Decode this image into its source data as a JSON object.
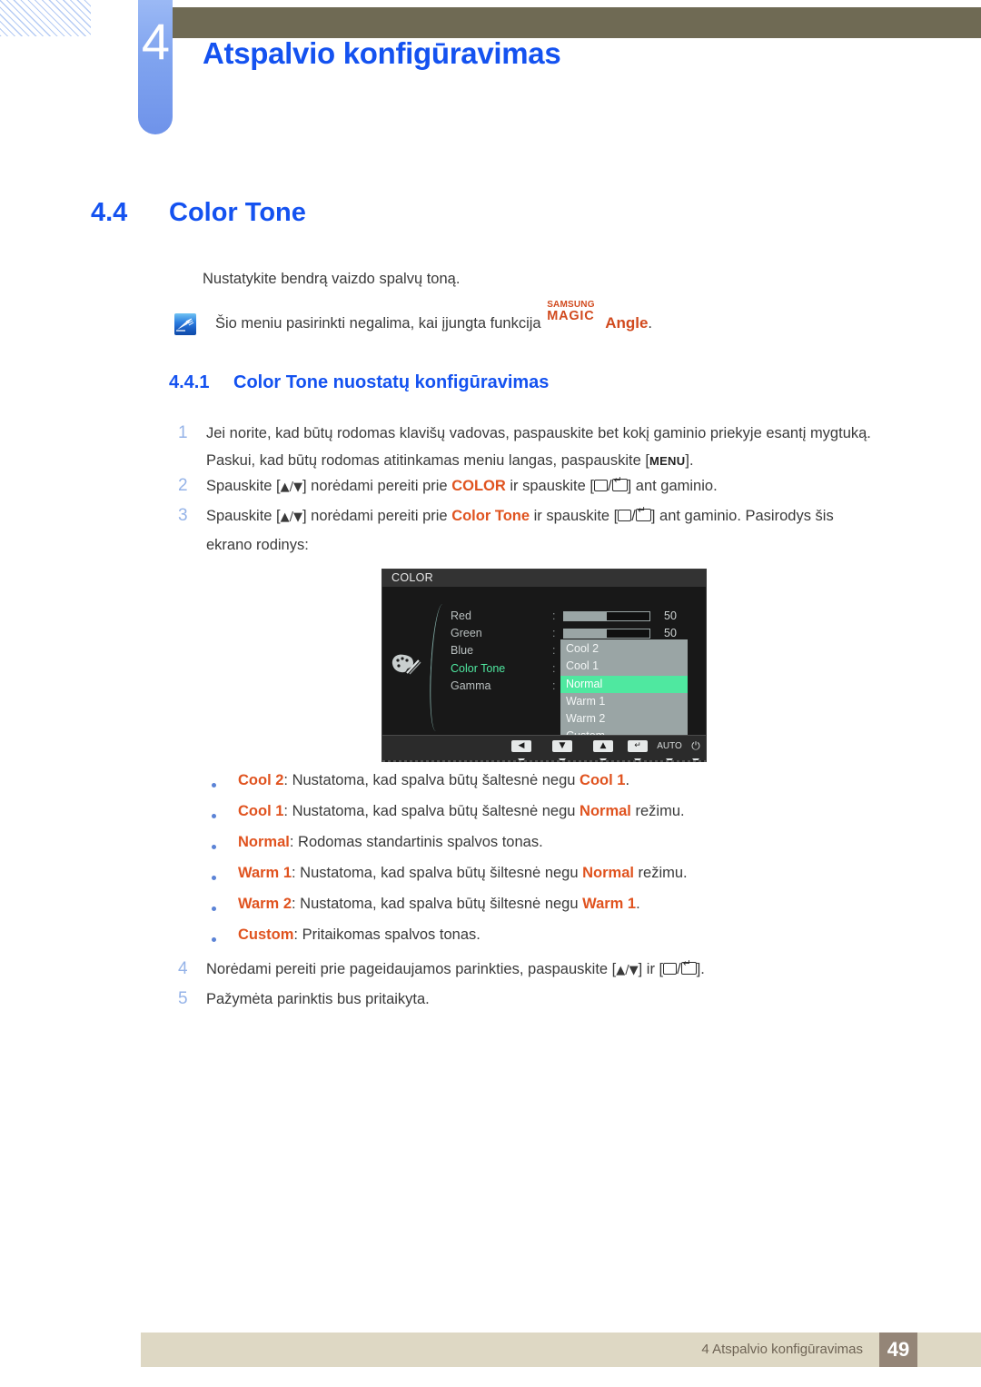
{
  "header": {
    "chapter_number": "4",
    "chapter_title": "Atspalvio konfigūravimas"
  },
  "section": {
    "number": "4.4",
    "title": "Color Tone"
  },
  "intro": "Nustatykite bendrą vaizdo spalvų toną.",
  "note": {
    "icon": "note-pen-icon",
    "text_before": "Šio meniu pasirinkti negalima, kai įjungta funkcija ",
    "logo_samsung": "SAMSUNG",
    "logo_magic": "MAGIC",
    "logo_angle": "Angle",
    "text_after": "."
  },
  "subsection": {
    "number": "4.4.1",
    "title": "Color Tone nuostatų konfigūravimas"
  },
  "steps": [
    {
      "num": "1",
      "line1_a": "Jei norite, kad būtų rodomas klavišų vadovas, paspauskite bet kokį gaminio priekyje esantį mygtuką.",
      "line2_a": "Paskui, kad būtų rodomas atitinkamas meniu langas, paspauskite [",
      "line2_key": "MENU",
      "line2_b": "]."
    },
    {
      "num": "2",
      "a": "Spauskite [",
      "keys": "▲/▼",
      "b": "] norėdami pereiti prie ",
      "highlight": "COLOR",
      "c": " ir spauskite [",
      "d": "] ant gaminio."
    },
    {
      "num": "3",
      "a": "Spauskite [",
      "keys": "▲/▼",
      "b": "] norėdami pereiti prie ",
      "highlight": "Color Tone",
      "c": " ir spauskite [",
      "d": "] ant gaminio. Pasirodys šis",
      "line2": "ekrano rodinys:"
    },
    {
      "num": "4",
      "a": "Norėdami pereiti prie pageidaujamos parinkties, paspauskite [",
      "keys": "▲/▼",
      "b": "] ir [",
      "d": "]."
    },
    {
      "num": "5",
      "a": "Pažymėta parinktis bus pritaikyta."
    }
  ],
  "osd": {
    "title": "COLOR",
    "menu_labels": [
      "Red",
      "Green",
      "Blue",
      "Color Tone",
      "Gamma"
    ],
    "selected_label": "Color Tone",
    "colon": ":",
    "sliders": [
      {
        "label": "Red",
        "value": "50",
        "fill_percent": 50
      },
      {
        "label": "Green",
        "value": "50",
        "fill_percent": 50
      }
    ],
    "dropdown_options": [
      "Cool 2",
      "Cool 1",
      "Normal",
      "Warm 1",
      "Warm 2",
      "Custom"
    ],
    "dropdown_selected": "Normal",
    "buttons": [
      {
        "name": "left-arrow-button",
        "glyph": "◀"
      },
      {
        "name": "down-arrow-button",
        "glyph": "▼"
      },
      {
        "name": "up-arrow-button",
        "glyph": "▲"
      },
      {
        "name": "enter-button",
        "glyph": "↵"
      },
      {
        "name": "auto-button",
        "glyph": "AUTO"
      },
      {
        "name": "power-button",
        "glyph": "⏻"
      }
    ],
    "colors": {
      "background": "#181818",
      "titlebar": "#333333",
      "highlight_green": "#4fe8a0",
      "dropdown_bg": "#9aa5a5"
    }
  },
  "bullets": [
    {
      "term": "Cool 2",
      "mid": ": Nustatoma, kad spalva būtų šaltesnė negu ",
      "term2": "Cool 1",
      "end": "."
    },
    {
      "term": "Cool 1",
      "mid": ": Nustatoma, kad spalva būtų šaltesnė negu ",
      "term2": "Normal",
      "end": " režimu."
    },
    {
      "term": "Normal",
      "mid": ": Rodomas standartinis spalvos tonas.",
      "term2": "",
      "end": ""
    },
    {
      "term": "Warm 1",
      "mid": ": Nustatoma, kad spalva būtų šiltesnė negu ",
      "term2": "Normal",
      "end": " režimu."
    },
    {
      "term": "Warm 2",
      "mid": ": Nustatoma, kad spalva būtų šiltesnė negu ",
      "term2": "Warm 1",
      "end": "."
    },
    {
      "term": "Custom",
      "mid": ": Pritaikomas spalvos tonas.",
      "term2": "",
      "end": ""
    }
  ],
  "footer": {
    "label": "4 Atspalvio konfigūravimas",
    "page_number": "49"
  },
  "colors": {
    "heading_blue": "#1452f0",
    "accent_orange": "#e0531f",
    "olive_bar": "#6f6a54",
    "footer_bg": "#ded8c4",
    "footer_page_bg": "#948577"
  }
}
